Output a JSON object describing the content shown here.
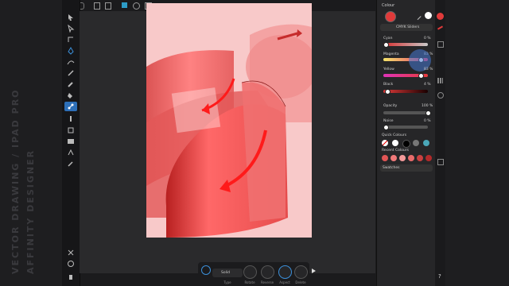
{
  "side_caption": {
    "line1": "VECTOR DRAWING / IPAD PRO",
    "line2": "AFFINITY DESIGNER"
  },
  "panel": {
    "title": "Colour",
    "mode": "CMYK Sliders",
    "fill_color": "#e03a3a",
    "sliders": [
      {
        "label": "Cyan",
        "value": "0 %",
        "level": 0.0
      },
      {
        "label": "Magenta",
        "value": "83 %",
        "level": 0.83
      },
      {
        "label": "Yellow",
        "value": "83 %",
        "level": 0.83
      },
      {
        "label": "Black",
        "value": "4 %",
        "level": 0.04
      }
    ],
    "opacity": {
      "label": "Opacity",
      "value": "100 %",
      "level": 1.0
    },
    "noise": {
      "label": "Noise",
      "value": "0 %",
      "level": 0.0
    },
    "quick_colours_label": "Quick Colours",
    "quick_colours": [
      "#ffffff",
      "#000000",
      "#777777",
      "#bfbfbf",
      "#4aa7b8"
    ],
    "recent_colours_label": "Recent Colours",
    "recent_colours": [
      "#e05555",
      "#f07a7a",
      "#f39a9a",
      "#e86b6b",
      "#c94040",
      "#b32a2a"
    ],
    "swatches_label": "Swatches"
  },
  "context_bar": {
    "type_value": "Solid",
    "labels": [
      "Type",
      "Rotate",
      "Reverse",
      "Aspect",
      "Delete"
    ]
  },
  "studio_help": "?"
}
